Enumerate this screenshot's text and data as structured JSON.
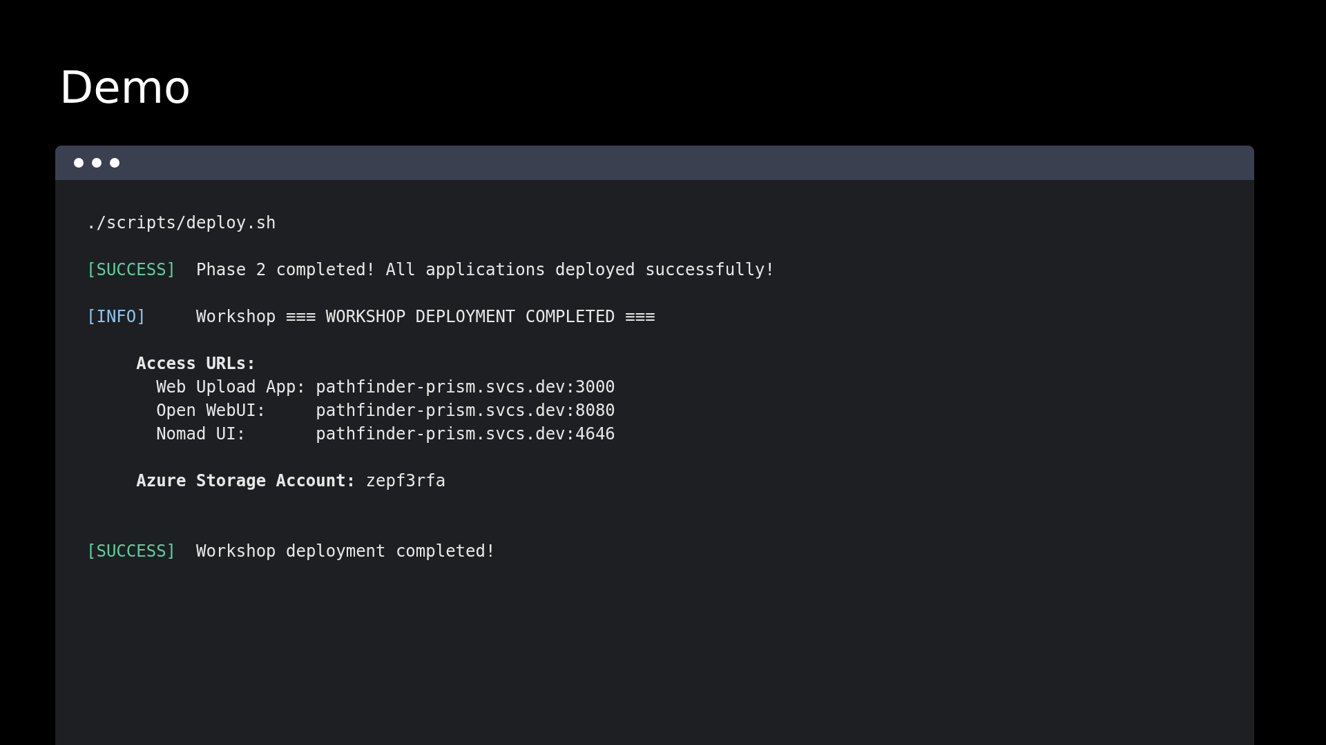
{
  "slide_title": "Demo",
  "terminal": {
    "blocks": [
      [
        {
          "kind": "command",
          "text": "./scripts/deploy.sh"
        }
      ],
      [
        {
          "kind": "log",
          "color": "#5ccf9e",
          "tag": "[SUCCESS]",
          "message": "Phase 2 completed! All applications deployed successfully!"
        }
      ],
      [
        {
          "kind": "log",
          "color": "#8cc4ea",
          "tag": "[INFO]",
          "message": "Workshop ≡≡≡ WORKSHOP DEPLOYMENT COMPLETED ≡≡≡"
        }
      ],
      [
        {
          "kind": "heading",
          "text": "Access URLs:"
        },
        {
          "kind": "field",
          "label": "Web Upload App:",
          "value": "pathfinder-prism.svcs.dev:3000"
        },
        {
          "kind": "field",
          "label": "Open WebUI:",
          "value": "pathfinder-prism.svcs.dev:8080"
        },
        {
          "kind": "field",
          "label": "Nomad UI:",
          "value": "pathfinder-prism.svcs.dev:4646"
        }
      ],
      [
        {
          "kind": "pair",
          "label": "Azure Storage Account:",
          "value": "zepf3rfa"
        }
      ],
      [
        {
          "kind": "log",
          "color": "#5ccf9e",
          "tag": "[SUCCESS]",
          "message": "Workshop deployment completed!"
        }
      ]
    ]
  }
}
